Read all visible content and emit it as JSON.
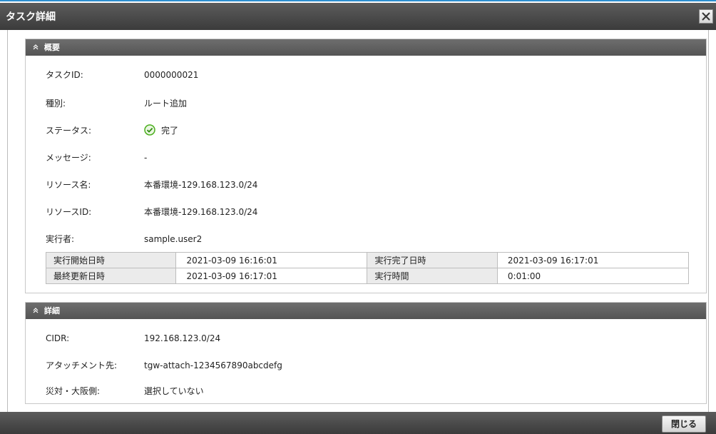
{
  "dialog": {
    "title": "タスク詳細",
    "close_footer_label": "閉じる"
  },
  "overview": {
    "header": "概要",
    "fields": [
      {
        "label": "タスクID:",
        "value": "0000000021"
      },
      {
        "label": "種別:",
        "value": "ルート追加"
      },
      {
        "label": "ステータス:",
        "value": "完了",
        "icon": "check-circle-icon"
      },
      {
        "label": "メッセージ:",
        "value": "-"
      },
      {
        "label": "リソース名:",
        "value": "本番環境-129.168.123.0/24"
      },
      {
        "label": "リソースID:",
        "value": "本番環境-129.168.123.0/24"
      },
      {
        "label": "実行者:",
        "value": "sample.user2"
      }
    ],
    "times": [
      {
        "h1": "実行開始日時",
        "v1": "2021-03-09 16:16:01",
        "h2": "実行完了日時",
        "v2": "2021-03-09 16:17:01"
      },
      {
        "h1": "最終更新日時",
        "v1": "2021-03-09 16:17:01",
        "h2": "実行時間",
        "v2": "0:01:00"
      }
    ]
  },
  "details": {
    "header": "詳細",
    "fields": [
      {
        "label": "CIDR:",
        "value": "192.168.123.0/24"
      },
      {
        "label": "アタッチメント先:",
        "value": "tgw-attach-1234567890abcdefg"
      },
      {
        "label": "災対・大阪側:",
        "value": "選択していない"
      }
    ]
  },
  "colors": {
    "accent_top": "#2d8fd0",
    "status_green": "#4caf1e",
    "bar_dark": "#3b3b3b"
  }
}
